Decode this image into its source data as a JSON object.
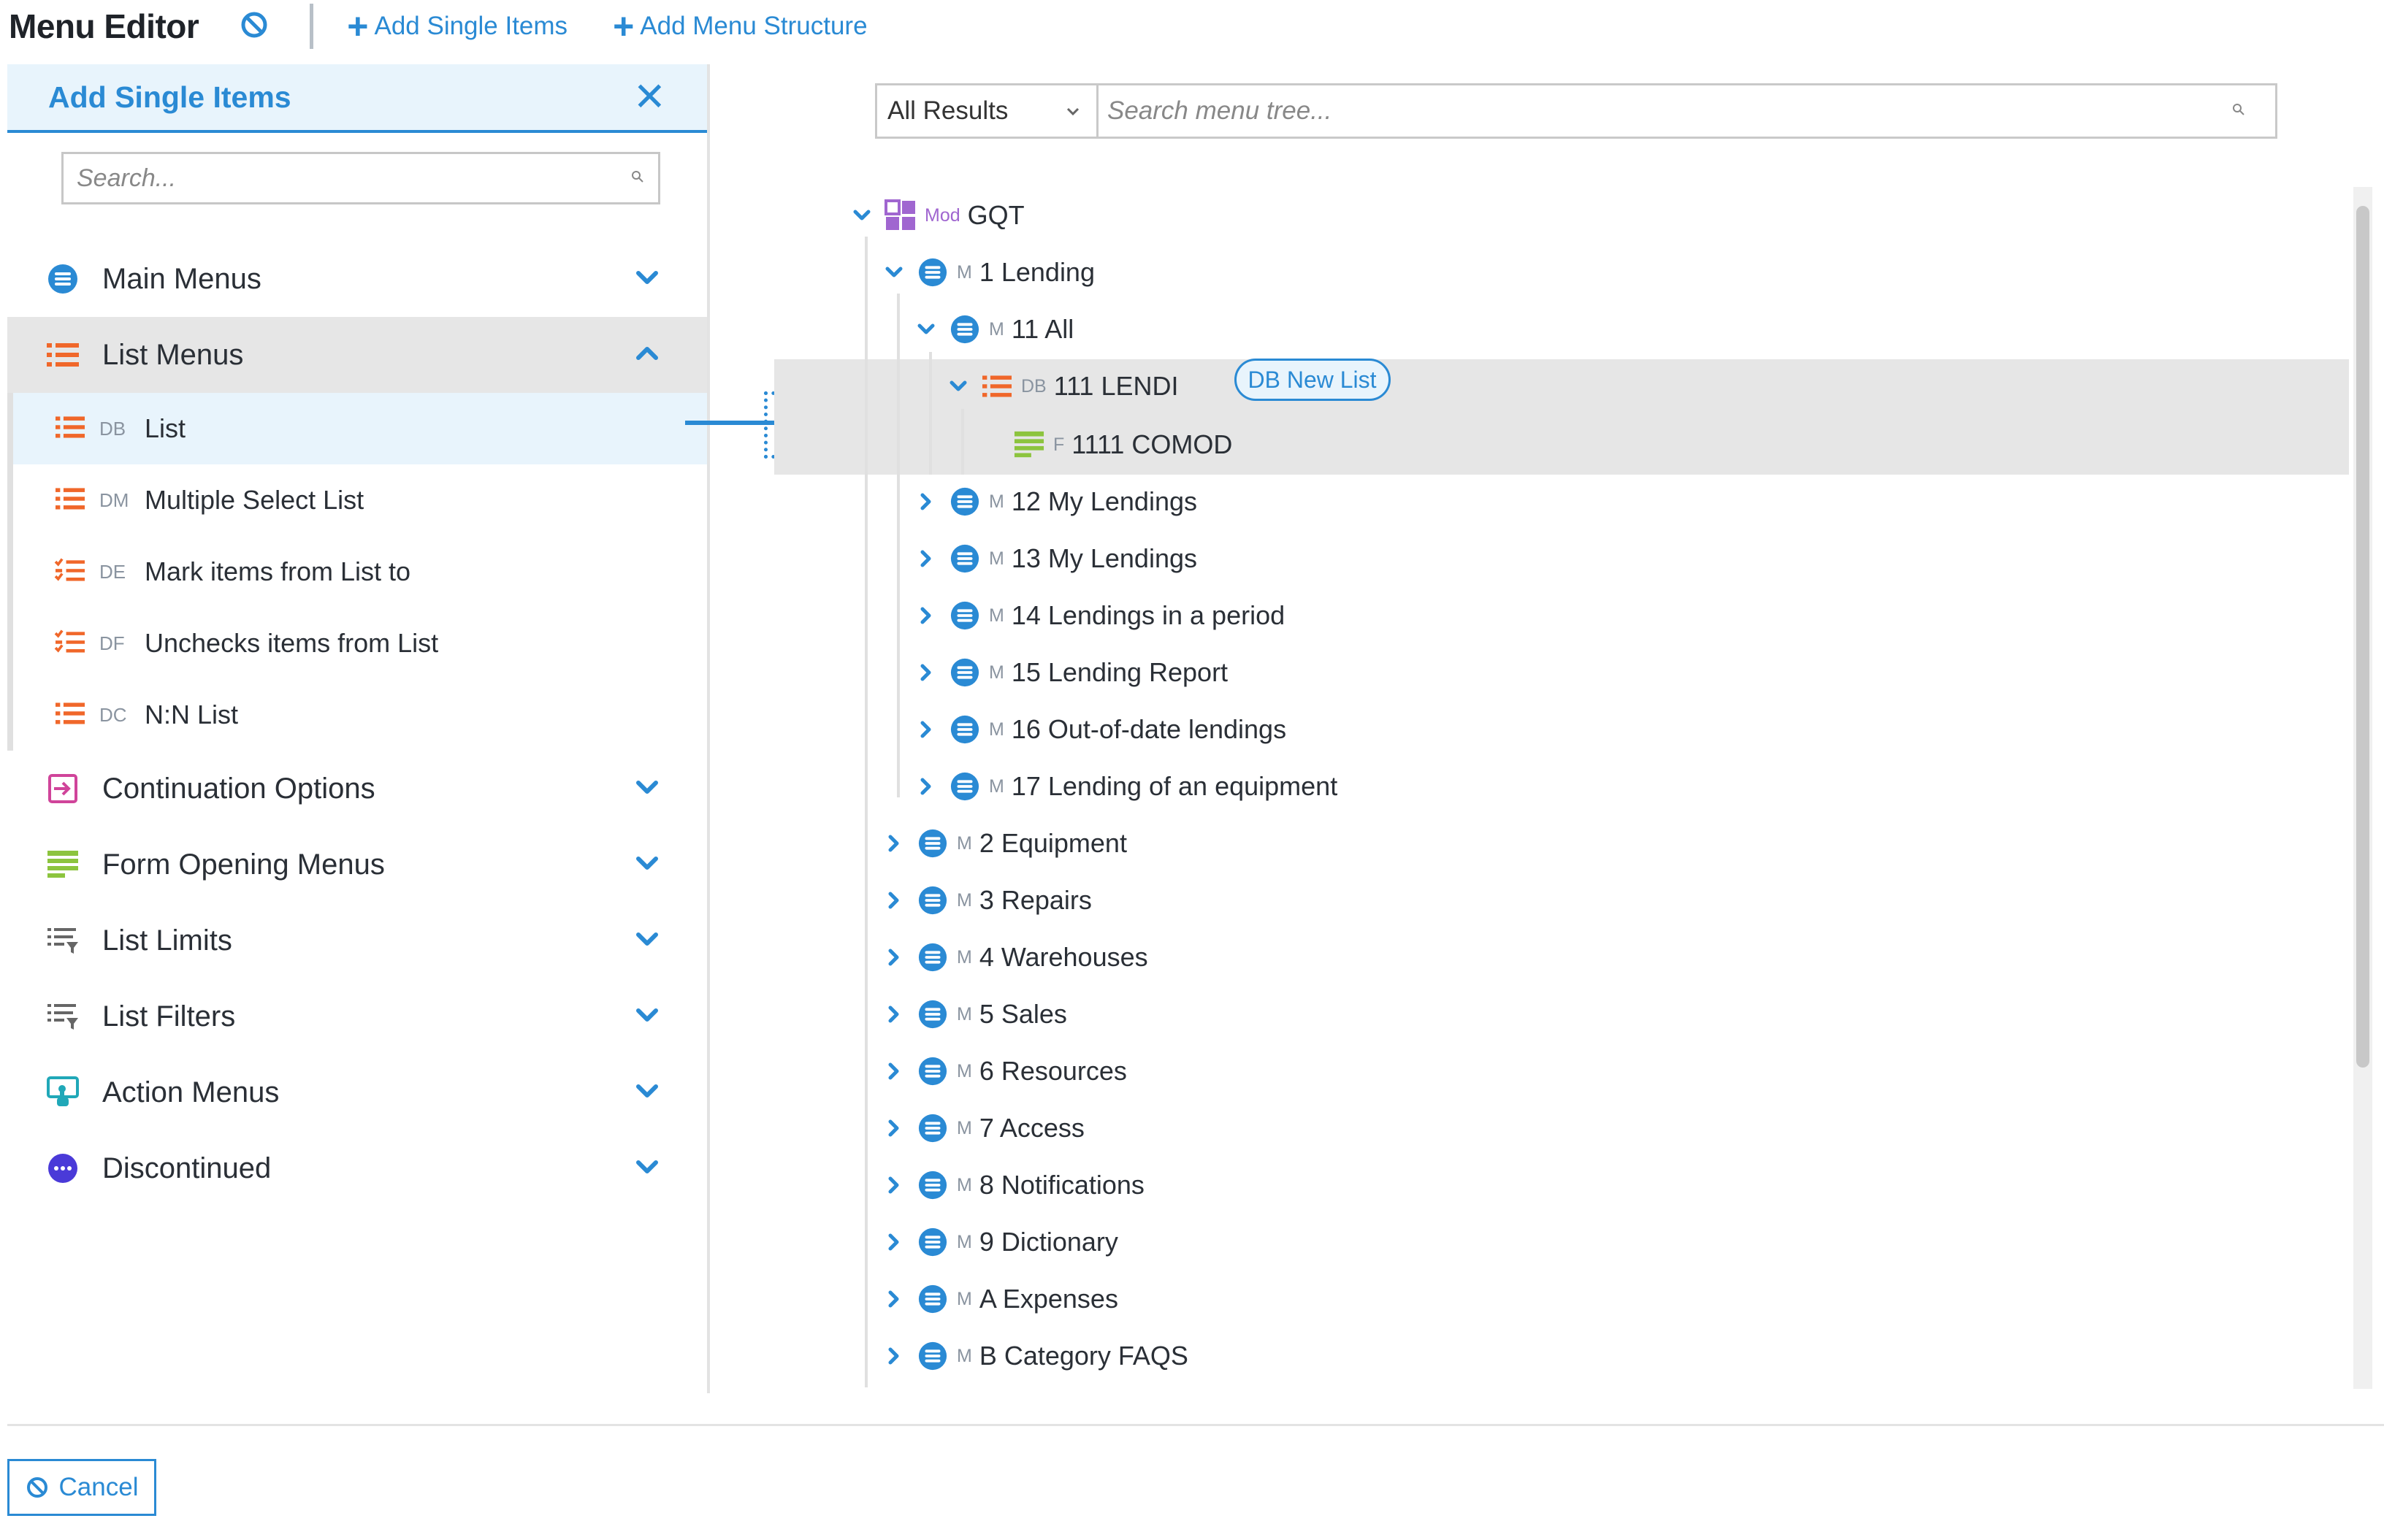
{
  "header": {
    "title": "Menu Editor",
    "add_single_items": "Add Single Items",
    "add_menu_structure": "Add Menu Structure"
  },
  "left_panel": {
    "title": "Add Single Items",
    "search_placeholder": "Search...",
    "categories": [
      {
        "label": "Main Menus",
        "icon": "list-circle-icon"
      },
      {
        "label": "List Menus",
        "icon": "list-bullets-icon",
        "expanded": true
      },
      {
        "label": "Continuation Options",
        "icon": "continuation-icon"
      },
      {
        "label": "Form Opening Menus",
        "icon": "form-icon"
      },
      {
        "label": "List Limits",
        "icon": "list-filter-icon"
      },
      {
        "label": "List Filters",
        "icon": "list-filter-icon"
      },
      {
        "label": "Action Menus",
        "icon": "action-touch-icon"
      },
      {
        "label": "Discontinued",
        "icon": "more-dots-icon"
      }
    ],
    "list_menu_items": [
      {
        "code": "DB",
        "label": "List",
        "selected": true
      },
      {
        "code": "DM",
        "label": "Multiple Select List"
      },
      {
        "code": "DE",
        "label": "Mark items from List to"
      },
      {
        "code": "DF",
        "label": "Unchecks items from List"
      },
      {
        "code": "DC",
        "label": "N:N List"
      }
    ]
  },
  "right_panel": {
    "filter_value": "All Results",
    "search_placeholder": "Search menu tree...",
    "badge": "DB New List",
    "tree": [
      {
        "code": "Mod",
        "label": "GQT"
      },
      {
        "code": "M",
        "label": "1 Lending"
      },
      {
        "code": "M",
        "label": "11 All"
      },
      {
        "code": "DB",
        "label": "111 LENDI"
      },
      {
        "code": "F",
        "label": "1111 COMOD"
      },
      {
        "code": "M",
        "label": "12 My Lendings"
      },
      {
        "code": "M",
        "label": "13 My Lendings"
      },
      {
        "code": "M",
        "label": "14 Lendings in a period"
      },
      {
        "code": "M",
        "label": "15 Lending Report"
      },
      {
        "code": "M",
        "label": "16 Out-of-date lendings"
      },
      {
        "code": "M",
        "label": "17 Lending of an equipment"
      },
      {
        "code": "M",
        "label": "2 Equipment"
      },
      {
        "code": "M",
        "label": "3 Repairs"
      },
      {
        "code": "M",
        "label": "4 Warehouses"
      },
      {
        "code": "M",
        "label": "5 Sales"
      },
      {
        "code": "M",
        "label": "6 Resources"
      },
      {
        "code": "M",
        "label": "7 Access"
      },
      {
        "code": "M",
        "label": "8 Notifications"
      },
      {
        "code": "M",
        "label": "9 Dictionary"
      },
      {
        "code": "M",
        "label": "A Expenses"
      },
      {
        "code": "M",
        "label": "B Category FAQS"
      }
    ]
  },
  "footer": {
    "cancel_label": "Cancel"
  },
  "colors": {
    "accent": "#2a8ad4",
    "list_orange": "#f0672a",
    "form_green": "#8cc43e",
    "module_purple": "#a066d0",
    "continuation_pink": "#d0449a",
    "action_teal": "#20a8b8",
    "discontinued_indigo": "#4a3ad8"
  }
}
